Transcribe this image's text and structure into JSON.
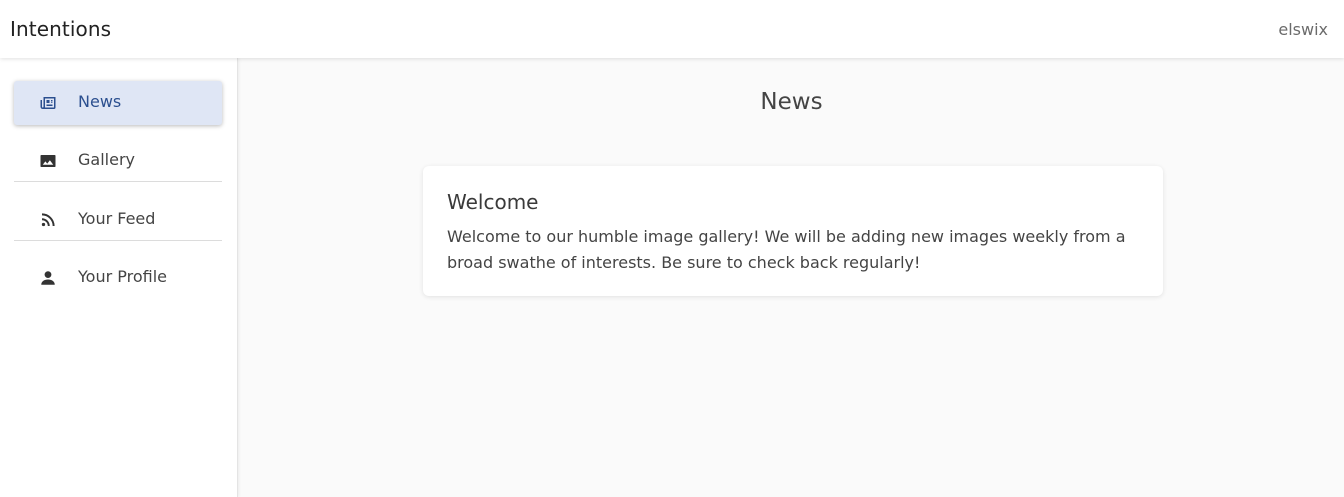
{
  "header": {
    "app_title": "Intentions",
    "user": "elswix"
  },
  "sidebar": {
    "items": [
      {
        "label": "News",
        "icon": "newspaper-icon",
        "active": true
      },
      {
        "label": "Gallery",
        "icon": "image-icon",
        "active": false
      },
      {
        "label": "Your Feed",
        "icon": "rss-feed-icon",
        "active": false
      },
      {
        "label": "Your Profile",
        "icon": "person-icon",
        "active": false
      }
    ]
  },
  "main": {
    "title": "News",
    "card": {
      "title": "Welcome",
      "body": "Welcome to our humble image gallery! We will be adding new images weekly from a broad swathe of interests. Be sure to check back regularly!"
    }
  },
  "colors": {
    "active_nav_bg": "#dfe6f5",
    "active_nav_text": "#2b4f8f",
    "page_bg": "#fafafa",
    "card_bg": "#ffffff"
  }
}
